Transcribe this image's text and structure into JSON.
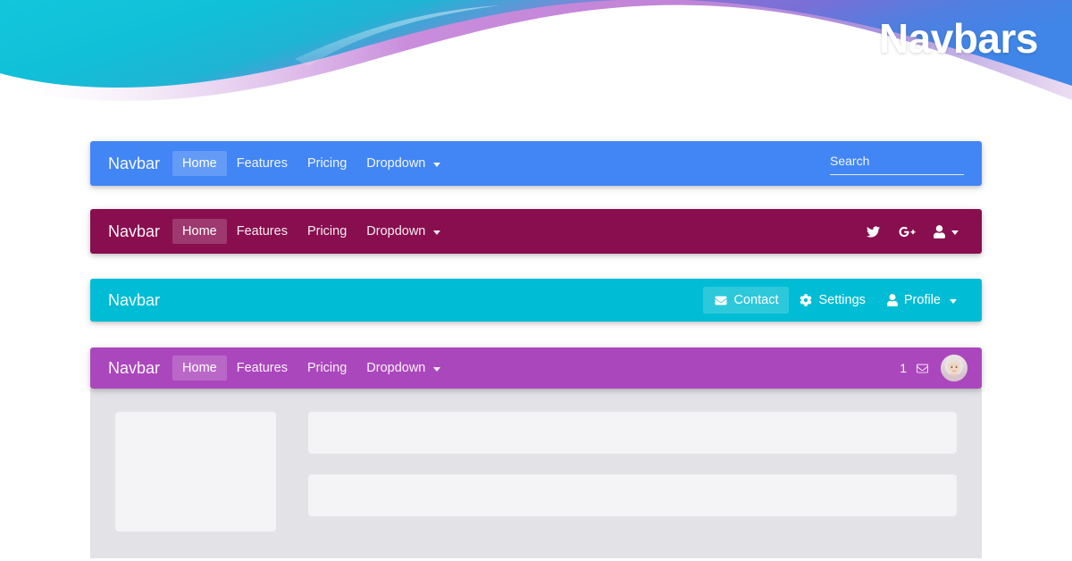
{
  "hero": {
    "title": "Navbars",
    "colors": {
      "cyan": "#17c1d6",
      "purple": "#b06ec8",
      "blue": "#3f7fe0",
      "background": "#ffffff"
    }
  },
  "navbars": [
    {
      "id": "navbar-blue",
      "brand": "Navbar",
      "color": "#4285f4",
      "links": [
        {
          "label": "Home",
          "active": true,
          "dropdown": false
        },
        {
          "label": "Features",
          "active": false,
          "dropdown": false
        },
        {
          "label": "Pricing",
          "active": false,
          "dropdown": false
        },
        {
          "label": "Dropdown",
          "active": false,
          "dropdown": true
        }
      ],
      "search": {
        "placeholder": "Search",
        "value": ""
      }
    },
    {
      "id": "navbar-maroon",
      "brand": "Navbar",
      "color": "#880e4f",
      "links": [
        {
          "label": "Home",
          "active": true,
          "dropdown": false
        },
        {
          "label": "Features",
          "active": false,
          "dropdown": false
        },
        {
          "label": "Pricing",
          "active": false,
          "dropdown": false
        },
        {
          "label": "Dropdown",
          "active": false,
          "dropdown": true
        }
      ],
      "icons": [
        {
          "name": "twitter-icon"
        },
        {
          "name": "google-plus-icon"
        },
        {
          "name": "user-icon",
          "dropdown": true
        }
      ]
    },
    {
      "id": "navbar-cyan",
      "brand": "Navbar",
      "color": "#00bcd4",
      "actions": [
        {
          "label": "Contact",
          "icon": "envelope-icon",
          "active": true,
          "dropdown": false
        },
        {
          "label": "Settings",
          "icon": "gear-icon",
          "active": false,
          "dropdown": false
        },
        {
          "label": "Profile",
          "icon": "user-icon",
          "active": false,
          "dropdown": true
        }
      ]
    },
    {
      "id": "navbar-purple",
      "brand": "Navbar",
      "color": "#ab47bc",
      "links": [
        {
          "label": "Home",
          "active": true,
          "dropdown": false
        },
        {
          "label": "Features",
          "active": false,
          "dropdown": false
        },
        {
          "label": "Pricing",
          "active": false,
          "dropdown": false
        },
        {
          "label": "Dropdown",
          "active": false,
          "dropdown": true
        }
      ],
      "messages": {
        "count": "1",
        "icon": "envelope-icon"
      },
      "avatar": {
        "name": "user-avatar"
      }
    }
  ],
  "content": {
    "background": "#e2e2e7",
    "placeholder_color": "#f4f4f6",
    "left_block": "",
    "right_blocks": [
      "",
      ""
    ]
  }
}
